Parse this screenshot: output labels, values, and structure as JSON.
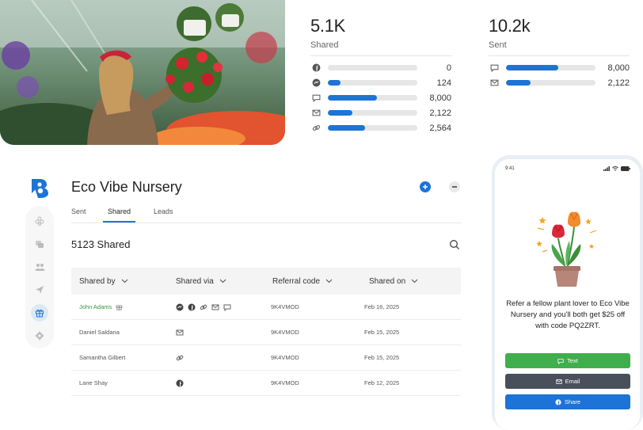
{
  "stats": {
    "shared": {
      "value": "5.1K",
      "label": "Shared",
      "rows": [
        {
          "icon": "facebook-icon",
          "fraction": 0.0,
          "count": "0"
        },
        {
          "icon": "messenger-icon",
          "fraction": 0.14,
          "count": "124"
        },
        {
          "icon": "sms-icon",
          "fraction": 0.55,
          "count": "8,000"
        },
        {
          "icon": "email-icon",
          "fraction": 0.27,
          "count": "2,122"
        },
        {
          "icon": "link-icon",
          "fraction": 0.42,
          "count": "2,564"
        }
      ]
    },
    "sent": {
      "value": "10.2k",
      "label": "Sent",
      "rows": [
        {
          "icon": "sms-icon",
          "fraction": 0.58,
          "count": "8,000"
        },
        {
          "icon": "email-icon",
          "fraction": 0.27,
          "count": "2,122"
        }
      ]
    }
  },
  "app": {
    "title": "Eco Vibe Nursery",
    "tabs": [
      "Sent",
      "Shared",
      "Leads"
    ],
    "active_tab": "Shared",
    "count_title": "5123 Shared",
    "columns": [
      "Shared by",
      "Shared via",
      "Referral code",
      "Shared on"
    ],
    "rows": [
      {
        "name": "John Adams",
        "via": [
          "messenger-icon",
          "facebook-icon",
          "link-icon",
          "email-icon",
          "sms-icon"
        ],
        "code": "9K4VMOD",
        "date": "Feb 16, 2025",
        "highlight": true
      },
      {
        "name": "Daniel Saldana",
        "via": [
          "email-icon"
        ],
        "code": "9K4VMOD",
        "date": "Feb 15, 2025",
        "highlight": false
      },
      {
        "name": "Samantha Gilbert",
        "via": [
          "link-icon"
        ],
        "code": "9K4VMOD",
        "date": "Feb 15, 2025",
        "highlight": false
      },
      {
        "name": "Lane Shay",
        "via": [
          "facebook-icon"
        ],
        "code": "9K4VMOD",
        "date": "Feb 12, 2025",
        "highlight": false
      }
    ],
    "sidebar_icons": [
      "flower-icon",
      "chat-icon",
      "users-icon",
      "send-icon",
      "gift-icon",
      "settings-icon"
    ],
    "active_sidebar": "gift-icon",
    "accent": "#1d73d6",
    "green": "#2c9a3c"
  },
  "phone": {
    "time": "9:41",
    "message": "Refer a fellow plant lover to Eco Vibe Nursery and you'll both get $25 off with code PQ2ZRT.",
    "buttons": {
      "text": "Text",
      "email": "Email",
      "share": "Share"
    },
    "colors": {
      "text": "#3fae4c",
      "email": "#4a4f5c",
      "share": "#1d73d6"
    }
  }
}
